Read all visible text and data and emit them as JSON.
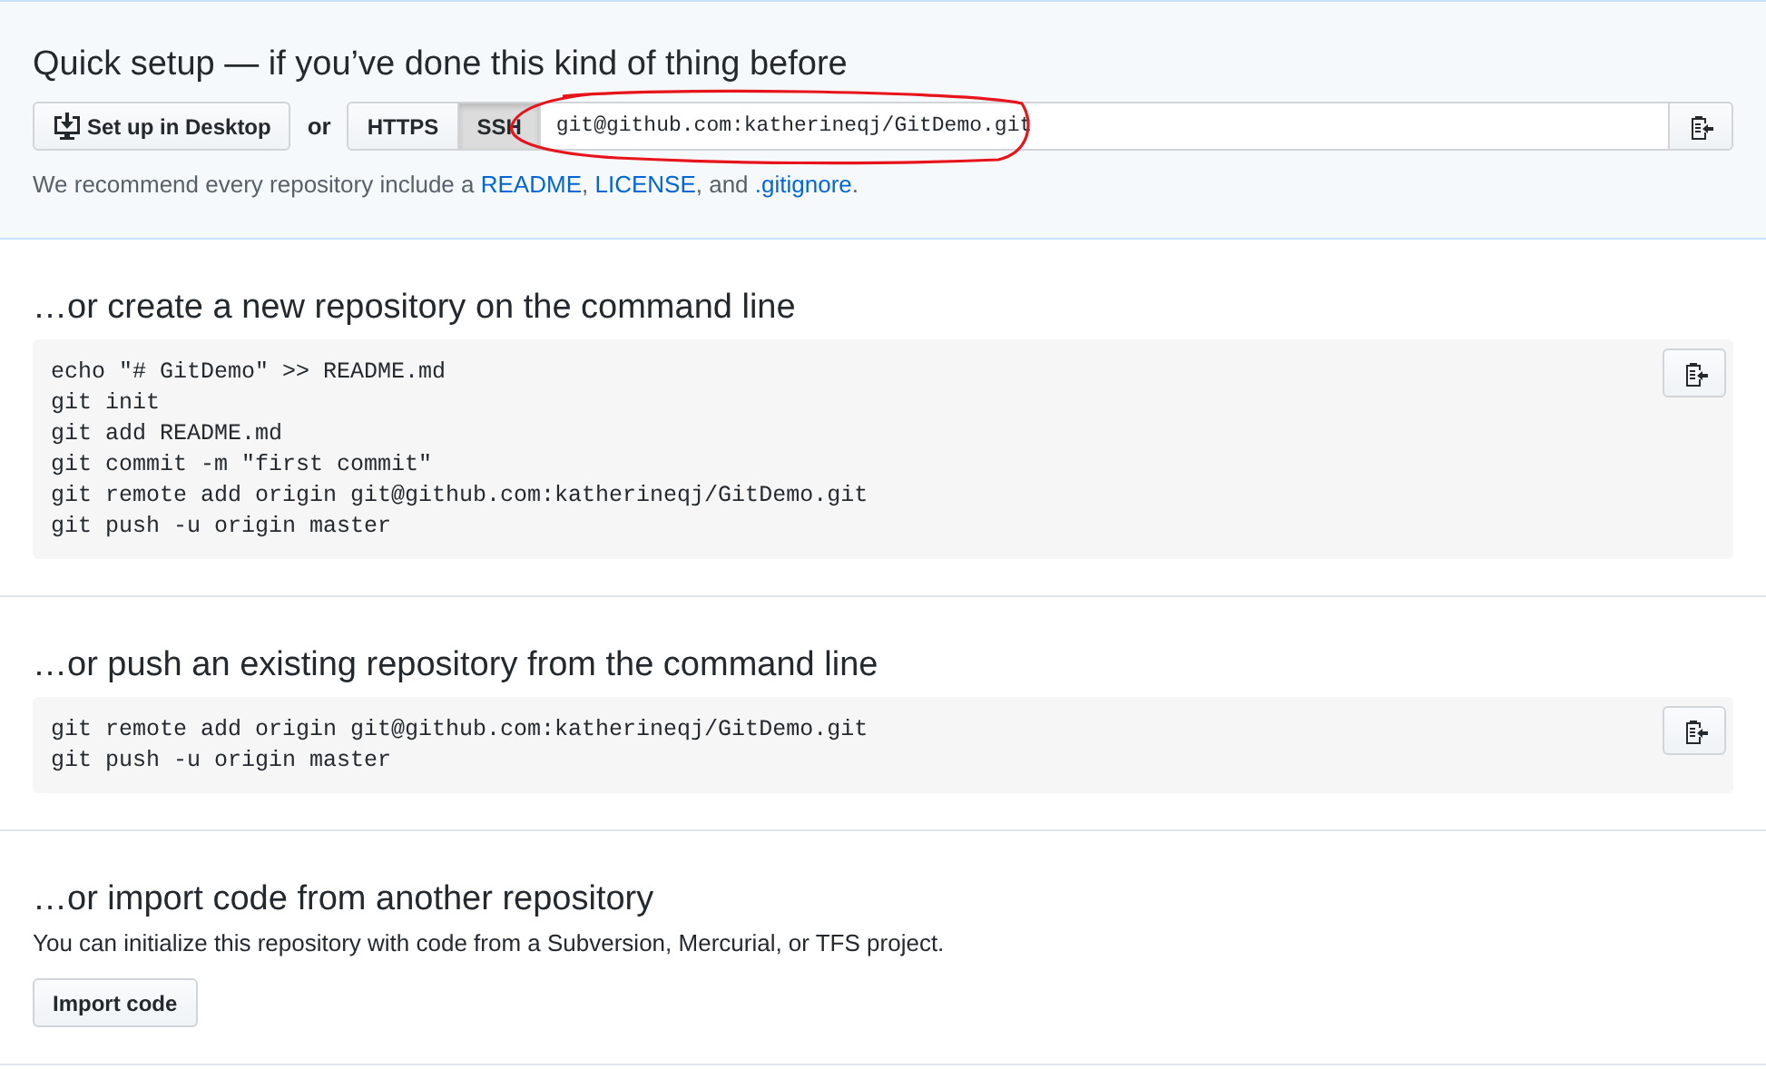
{
  "quick_setup": {
    "title": "Quick setup — if you’ve done this kind of thing before",
    "desktop_button": "Set up in Desktop",
    "or": "or",
    "protocols": [
      {
        "label": "HTTPS",
        "selected": false
      },
      {
        "label": "SSH",
        "selected": true
      }
    ],
    "url": "git@github.com:katherineqj/GitDemo.git",
    "recommend": [
      {
        "text": "We recommend every repository include a ",
        "link": false
      },
      {
        "text": "README",
        "link": true
      },
      {
        "text": ", ",
        "link": false
      },
      {
        "text": "LICENSE",
        "link": true
      },
      {
        "text": ", and ",
        "link": false
      },
      {
        "text": ".gitignore",
        "link": true
      },
      {
        "text": ".",
        "link": false
      }
    ]
  },
  "sections": [
    {
      "title": "…or create a new repository on the command line",
      "code": [
        "echo \"# GitDemo\" >> README.md",
        "git init",
        "git add README.md",
        "git commit -m \"first commit\"",
        "git remote add origin git@github.com:katherineqj/GitDemo.git",
        "git push -u origin master"
      ]
    },
    {
      "title": "…or push an existing repository from the command line",
      "code": [
        "git remote add origin git@github.com:katherineqj/GitDemo.git",
        "git push -u origin master"
      ]
    }
  ],
  "import": {
    "title": "…or import code from another repository",
    "text": "You can initialize this repository with code from a Subversion, Mercurial, or TFS project.",
    "button": "Import code"
  }
}
